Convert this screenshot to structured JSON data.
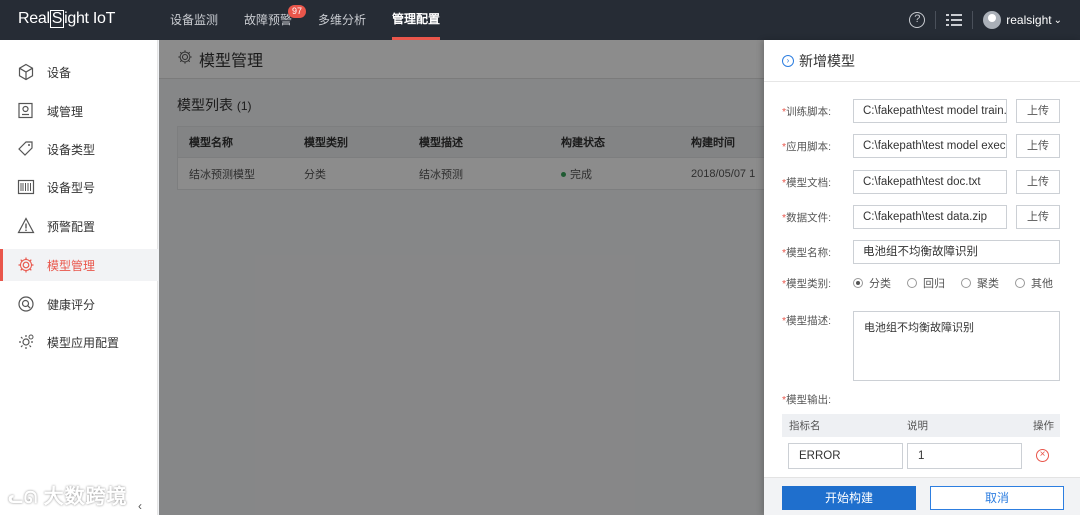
{
  "brand": {
    "part1": "Real",
    "boxed": "S",
    "part2": "ight IoT"
  },
  "nav": {
    "items": [
      {
        "label": "设备监测"
      },
      {
        "label": "故障预警",
        "badge": "97"
      },
      {
        "label": "多维分析"
      },
      {
        "label": "管理配置",
        "active": true
      }
    ]
  },
  "header_right": {
    "help": "?",
    "user": "realsight",
    "user_caret": "⌄"
  },
  "sidebar": {
    "items": [
      {
        "label": "设备",
        "icon": "cube-icon"
      },
      {
        "label": "域管理",
        "icon": "map-pin-icon"
      },
      {
        "label": "设备类型",
        "icon": "tag-icon"
      },
      {
        "label": "设备型号",
        "icon": "barcode-icon"
      },
      {
        "label": "预警配置",
        "icon": "warning-icon"
      },
      {
        "label": "模型管理",
        "icon": "gear-icon",
        "active": true
      },
      {
        "label": "健康评分",
        "icon": "health-icon"
      },
      {
        "label": "模型应用配置",
        "icon": "model-config-icon"
      }
    ],
    "watermark": "大数跨境",
    "collapse": "‹"
  },
  "main": {
    "title": "模型管理",
    "list_title": "模型列表",
    "list_count": "(1)",
    "table": {
      "headers": [
        "模型名称",
        "模型类别",
        "模型描述",
        "构建状态",
        "构建时间"
      ],
      "rows": [
        [
          "结冰预测模型",
          "分类",
          "结冰预测",
          "完成",
          "2018/05/07 1"
        ]
      ]
    }
  },
  "drawer": {
    "title": "新增模型",
    "required_mark": "*",
    "fields": {
      "train_script": {
        "label": "训练脚本:",
        "value": "C:\\fakepath\\test model train.py",
        "button": "上传"
      },
      "app_script": {
        "label": "应用脚本:",
        "value": "C:\\fakepath\\test model exec.py",
        "button": "上传"
      },
      "model_doc": {
        "label": "模型文档:",
        "value": "C:\\fakepath\\test doc.txt",
        "button": "上传"
      },
      "data_file": {
        "label": "数据文件:",
        "value": "C:\\fakepath\\test data.zip",
        "button": "上传"
      },
      "model_name": {
        "label": "模型名称:",
        "value": "电池组不均衡故障识别"
      },
      "model_type": {
        "label": "模型类别:",
        "options": [
          "分类",
          "回归",
          "聚类",
          "其他"
        ],
        "selected": "分类"
      },
      "model_desc": {
        "label": "模型描述:",
        "value": "电池组不均衡故障识别"
      },
      "model_output": {
        "label": "模型输出:"
      }
    },
    "output_table": {
      "headers": [
        "指标名",
        "说明",
        "操作"
      ],
      "row": {
        "name": "ERROR",
        "desc": "1"
      }
    },
    "submit": "开始构建",
    "cancel": "取消"
  }
}
